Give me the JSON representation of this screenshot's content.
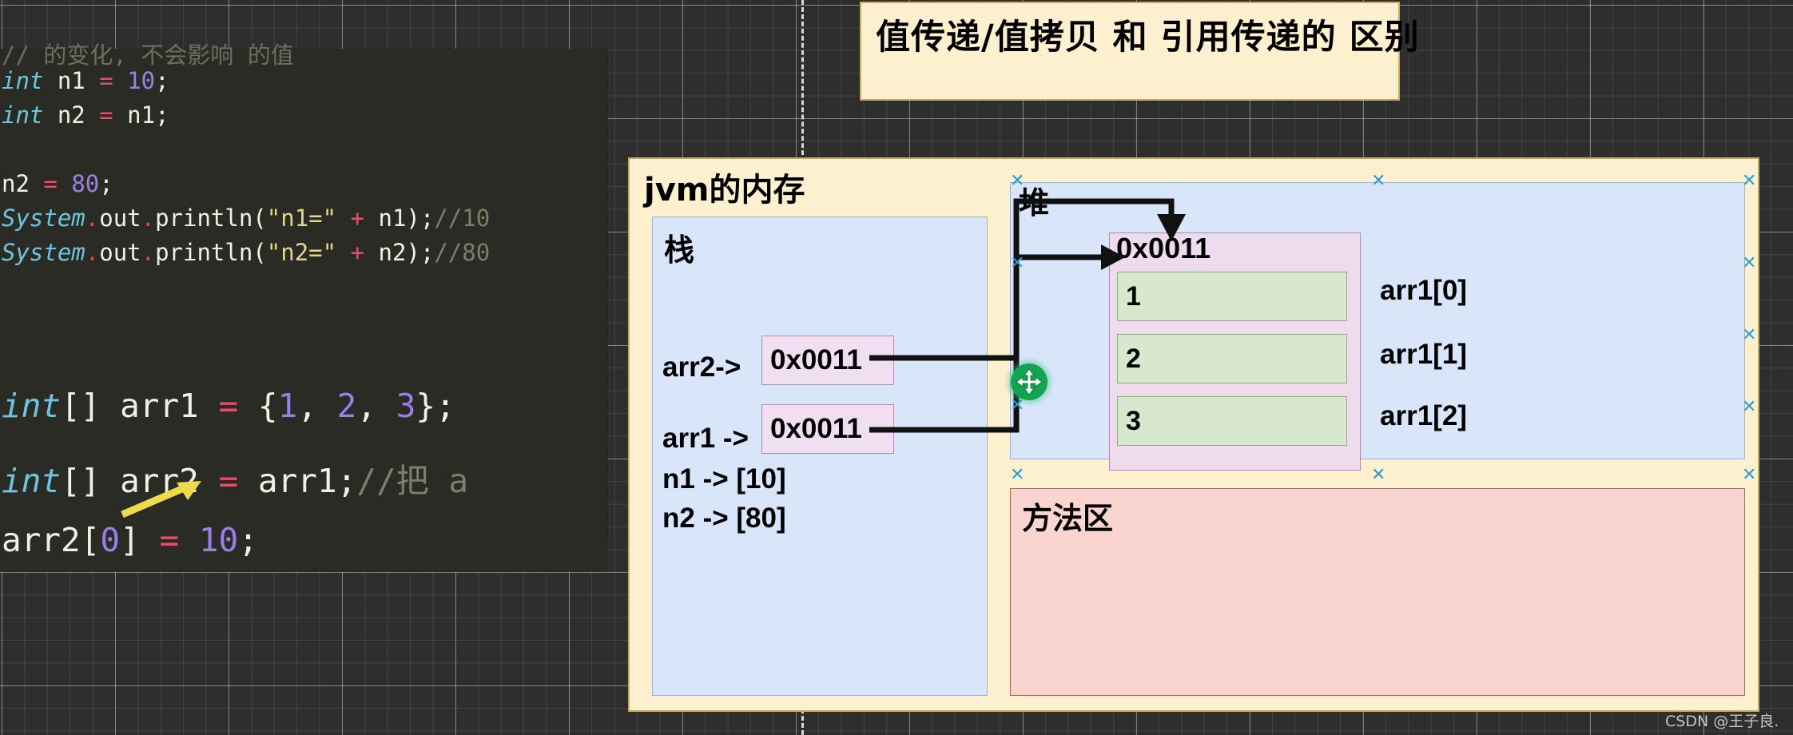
{
  "title_banner": {
    "text": "值传递/值拷贝 和 引用传递的 区别"
  },
  "code_panel": {
    "cut_comment_top": "// 的变化, 不会影响 的值",
    "lines_top": [
      {
        "segments": [
          {
            "t": "int",
            "c": "kw"
          },
          {
            "t": " n1 ",
            "c": "plain"
          },
          {
            "t": "=",
            "c": "op"
          },
          {
            "t": " ",
            "c": "plain"
          },
          {
            "t": "10",
            "c": "num"
          },
          {
            "t": ";",
            "c": "plain"
          }
        ]
      },
      {
        "segments": [
          {
            "t": "int",
            "c": "kw"
          },
          {
            "t": " n2 ",
            "c": "plain"
          },
          {
            "t": "=",
            "c": "op"
          },
          {
            "t": " n1;",
            "c": "plain"
          }
        ]
      },
      {
        "segments": []
      },
      {
        "segments": [
          {
            "t": "n2 ",
            "c": "plain"
          },
          {
            "t": "=",
            "c": "op"
          },
          {
            "t": " ",
            "c": "plain"
          },
          {
            "t": "80",
            "c": "num"
          },
          {
            "t": ";",
            "c": "plain"
          }
        ]
      },
      {
        "segments": [
          {
            "t": "System",
            "c": "kw"
          },
          {
            "t": ".",
            "c": "dot"
          },
          {
            "t": "out",
            "c": "plain"
          },
          {
            "t": ".",
            "c": "dot"
          },
          {
            "t": "println(",
            "c": "plain"
          },
          {
            "t": "\"n1=\"",
            "c": "str"
          },
          {
            "t": " ",
            "c": "plain"
          },
          {
            "t": "+",
            "c": "op"
          },
          {
            "t": " n1);",
            "c": "plain"
          },
          {
            "t": "//10",
            "c": "cmt"
          }
        ]
      },
      {
        "segments": [
          {
            "t": "System",
            "c": "kw"
          },
          {
            "t": ".",
            "c": "dot"
          },
          {
            "t": "out",
            "c": "plain"
          },
          {
            "t": ".",
            "c": "dot"
          },
          {
            "t": "println(",
            "c": "plain"
          },
          {
            "t": "\"n2=\"",
            "c": "str"
          },
          {
            "t": " ",
            "c": "plain"
          },
          {
            "t": "+",
            "c": "op"
          },
          {
            "t": " n2);",
            "c": "plain"
          },
          {
            "t": "//80",
            "c": "cmt"
          }
        ]
      }
    ],
    "lines_bottom": [
      {
        "segments": [
          {
            "t": "int",
            "c": "kw"
          },
          {
            "t": "[] arr1 ",
            "c": "plain"
          },
          {
            "t": "=",
            "c": "op"
          },
          {
            "t": " {",
            "c": "plain"
          },
          {
            "t": "1",
            "c": "num"
          },
          {
            "t": ", ",
            "c": "plain"
          },
          {
            "t": "2",
            "c": "num"
          },
          {
            "t": ", ",
            "c": "plain"
          },
          {
            "t": "3",
            "c": "num"
          },
          {
            "t": "};",
            "c": "plain"
          }
        ]
      },
      {
        "segments": [
          {
            "t": "int",
            "c": "kw"
          },
          {
            "t": "[] arr2 ",
            "c": "plain"
          },
          {
            "t": "=",
            "c": "op"
          },
          {
            "t": " arr1;",
            "c": "plain"
          },
          {
            "t": "//把 a",
            "c": "cmt"
          }
        ]
      },
      {
        "segments": [
          {
            "t": "arr2[",
            "c": "plain"
          },
          {
            "t": "0",
            "c": "num"
          },
          {
            "t": "] ",
            "c": "plain"
          },
          {
            "t": "=",
            "c": "op"
          },
          {
            "t": " ",
            "c": "plain"
          },
          {
            "t": "10",
            "c": "num"
          },
          {
            "t": ";",
            "c": "plain"
          }
        ]
      }
    ]
  },
  "jvm": {
    "title": "jvm的内存",
    "stack": {
      "label": "栈",
      "rows": [
        {
          "name": "arr2->",
          "boxed": true,
          "value": "0x0011"
        },
        {
          "name": "arr1 ->",
          "boxed": true,
          "value": "0x0011"
        },
        {
          "name": "n1 -> [10]",
          "boxed": false,
          "value": ""
        },
        {
          "name": "n2 -> [80]",
          "boxed": false,
          "value": ""
        }
      ]
    },
    "heap": {
      "label": "堆",
      "object_address": "0x0011",
      "cells": [
        {
          "value": "1",
          "index_label": "arr1[0]"
        },
        {
          "value": "2",
          "index_label": "arr1[1]"
        },
        {
          "value": "3",
          "index_label": "arr1[2]"
        }
      ]
    },
    "method_area": {
      "label": "方法区"
    }
  },
  "selection": {
    "handle_icon": "move-handle-icon",
    "marker": "✕"
  },
  "watermark": {
    "text": "CSDN @王子良."
  },
  "colors": {
    "canvas": "#2e2e2e",
    "card_bg": "#fdf0cf",
    "card_border": "#c9ab5e",
    "stack_bg": "#d9e6fa",
    "heap_object_bg": "#eedcee",
    "cell_bg": "#d8e8ce",
    "method_bg": "#fad4cf",
    "handle_green": "#13a452",
    "selection_blue": "#2f9bd4",
    "code_bg": "#2b2b26"
  }
}
